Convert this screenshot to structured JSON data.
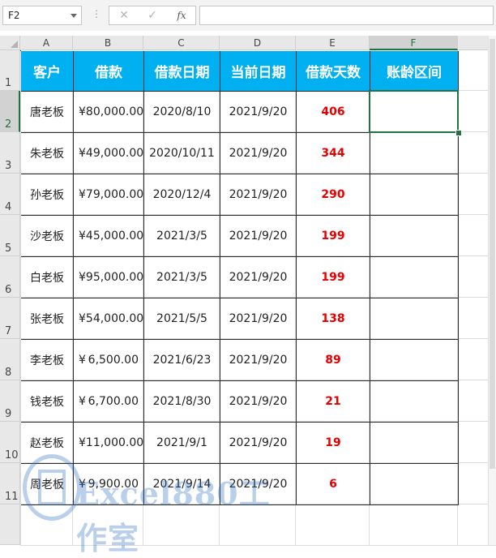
{
  "formula_bar": {
    "name_box": "F2",
    "cancel_glyph": "✕",
    "enter_glyph": "✓",
    "fx_label": "fx",
    "formula_value": ""
  },
  "columns": [
    "A",
    "B",
    "C",
    "D",
    "E",
    "F"
  ],
  "rows": [
    "1",
    "2",
    "3",
    "4",
    "5",
    "6",
    "7",
    "8",
    "9",
    "10",
    "11"
  ],
  "table": {
    "headers": [
      "客户",
      "借款",
      "借款日期",
      "当前日期",
      "借款天数",
      "账龄区间"
    ],
    "rows": [
      {
        "customer": "唐老板",
        "currency": "¥",
        "amount": "80,000.00",
        "loan_date": "2020/8/10",
        "current_date": "2021/9/20",
        "days": "406",
        "aging": ""
      },
      {
        "customer": "朱老板",
        "currency": "¥",
        "amount": "49,000.00",
        "loan_date": "2020/10/11",
        "current_date": "2021/9/20",
        "days": "344",
        "aging": ""
      },
      {
        "customer": "孙老板",
        "currency": "¥",
        "amount": "79,000.00",
        "loan_date": "2020/12/4",
        "current_date": "2021/9/20",
        "days": "290",
        "aging": ""
      },
      {
        "customer": "沙老板",
        "currency": "¥",
        "amount": "45,000.00",
        "loan_date": "2021/3/5",
        "current_date": "2021/9/20",
        "days": "199",
        "aging": ""
      },
      {
        "customer": "白老板",
        "currency": "¥",
        "amount": "95,000.00",
        "loan_date": "2021/3/5",
        "current_date": "2021/9/20",
        "days": "199",
        "aging": ""
      },
      {
        "customer": "张老板",
        "currency": "¥",
        "amount": "54,000.00",
        "loan_date": "2021/5/5",
        "current_date": "2021/9/20",
        "days": "138",
        "aging": ""
      },
      {
        "customer": "李老板",
        "currency": "¥",
        "amount": "6,500.00",
        "loan_date": "2021/6/23",
        "current_date": "2021/9/20",
        "days": "89",
        "aging": ""
      },
      {
        "customer": "钱老板",
        "currency": "¥",
        "amount": "6,700.00",
        "loan_date": "2021/8/30",
        "current_date": "2021/9/20",
        "days": "21",
        "aging": ""
      },
      {
        "customer": "赵老板",
        "currency": "¥",
        "amount": "11,000.00",
        "loan_date": "2021/9/1",
        "current_date": "2021/9/20",
        "days": "19",
        "aging": ""
      },
      {
        "customer": "周老板",
        "currency": "¥",
        "amount": "9,900.00",
        "loan_date": "2021/9/14",
        "current_date": "2021/9/20",
        "days": "6",
        "aging": ""
      }
    ]
  },
  "selected_cell": "F2",
  "colors": {
    "header_fill": "#00b0f0",
    "days_text": "#e60000",
    "selection": "#217346"
  },
  "watermark": {
    "text": "Excel880工作室"
  }
}
